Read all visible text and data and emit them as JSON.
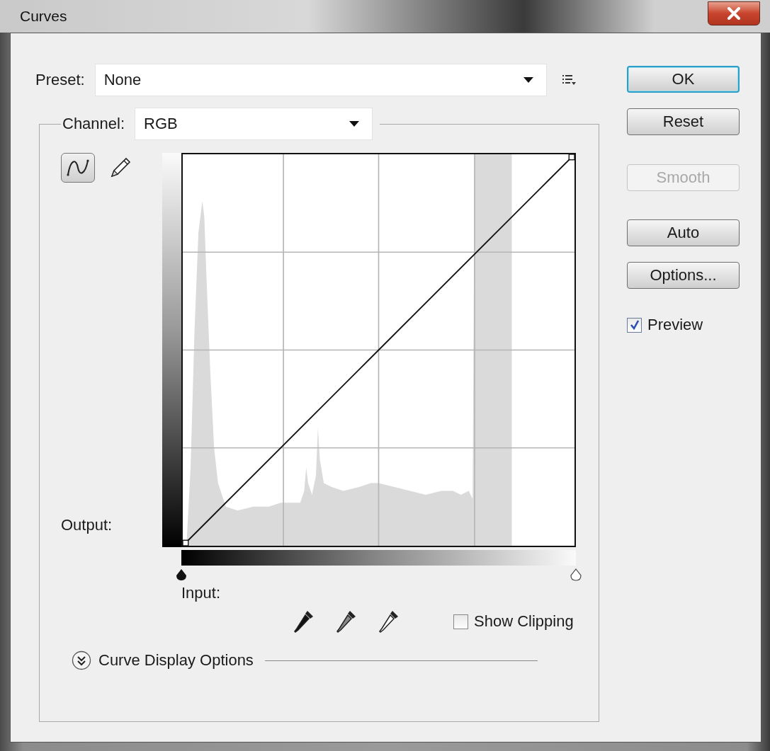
{
  "window": {
    "title": "Curves"
  },
  "preset": {
    "label": "Preset:",
    "value": "None"
  },
  "channel": {
    "label": "Channel:",
    "value": "RGB"
  },
  "curve_tools": [
    {
      "kind": "curve",
      "selected": true
    },
    {
      "kind": "pencil",
      "selected": false
    }
  ],
  "output_label": "Output:",
  "input_label": "Input:",
  "eyedroppers": [
    {
      "kind": "black"
    },
    {
      "kind": "gray"
    },
    {
      "kind": "white"
    }
  ],
  "show_clipping": {
    "label": "Show Clipping",
    "checked": false
  },
  "curve_display_options": {
    "label": "Curve Display Options",
    "expanded": false
  },
  "buttons": [
    {
      "label": "OK",
      "default": true,
      "disabled": false
    },
    {
      "label": "Reset",
      "default": false,
      "disabled": false
    },
    {
      "label": "Smooth",
      "default": false,
      "disabled": true
    },
    {
      "label": "Auto",
      "default": false,
      "disabled": false
    },
    {
      "label": "Options...",
      "default": false,
      "disabled": false
    }
  ],
  "preview": {
    "label": "Preview",
    "checked": true
  }
}
